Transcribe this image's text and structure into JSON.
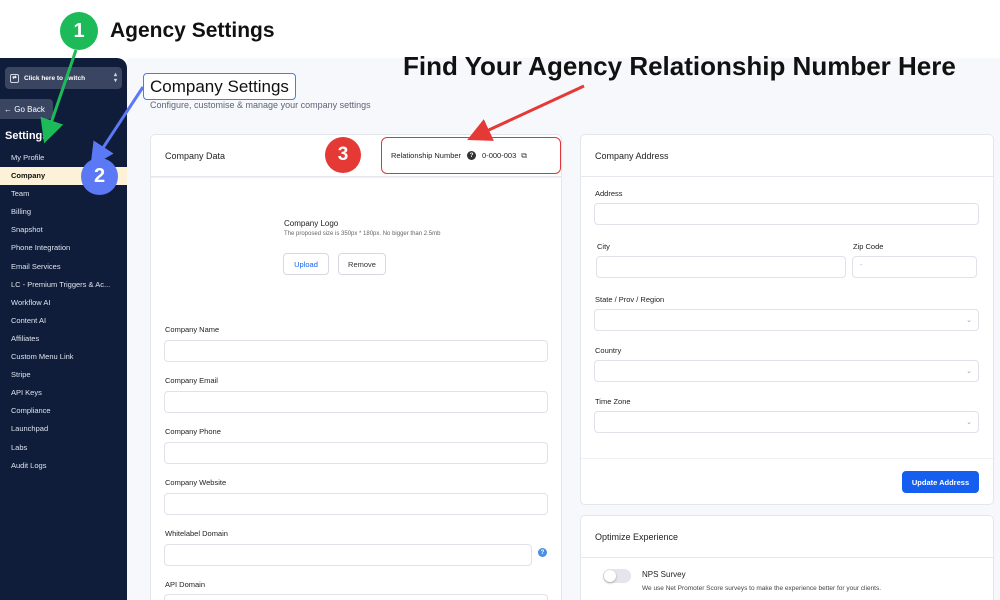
{
  "annotations": {
    "badge1": "1",
    "badge1_text": "Agency Settings",
    "badge2": "2",
    "badge3": "3",
    "headline": "Find Your Agency Relationship Number Here",
    "colors": {
      "green": "#1dba5a",
      "blue": "#5b79f5",
      "red": "#e53935"
    }
  },
  "sidebar": {
    "switcher_label": "Click here to switch",
    "go_back": "← Go Back",
    "title": "Settings",
    "items": [
      {
        "label": "My Profile"
      },
      {
        "label": "Company"
      },
      {
        "label": "Team"
      },
      {
        "label": "Billing"
      },
      {
        "label": "Snapshot"
      },
      {
        "label": "Phone Integration"
      },
      {
        "label": "Email Services"
      },
      {
        "label": "LC - Premium Triggers & Ac..."
      },
      {
        "label": "Workflow AI"
      },
      {
        "label": "Content AI"
      },
      {
        "label": "Affiliates"
      },
      {
        "label": "Custom Menu Link"
      },
      {
        "label": "Stripe"
      },
      {
        "label": "API Keys"
      },
      {
        "label": "Compliance"
      },
      {
        "label": "Launchpad"
      },
      {
        "label": "Labs"
      },
      {
        "label": "Audit Logs"
      }
    ],
    "active_index": 1
  },
  "page": {
    "title": "Company Settings",
    "subtitle": "Configure, customise & manage your company settings"
  },
  "company_data": {
    "header": "Company Data",
    "relationship_label": "Relationship Number",
    "relationship_number": "0-000-003",
    "logo_title": "Company Logo",
    "logo_hint": "The proposed size is 350px * 180px. No bigger than 2.5mb",
    "upload_label": "Upload",
    "remove_label": "Remove",
    "fields": {
      "name": "Company Name",
      "email": "Company Email",
      "phone": "Company Phone",
      "website": "Company Website",
      "whitelabel": "Whitelabel Domain",
      "api": "API Domain"
    }
  },
  "company_address": {
    "header": "Company Address",
    "address": "Address",
    "city": "City",
    "zip": "Zip Code",
    "zip_value": "-",
    "state": "State / Prov / Region",
    "country": "Country",
    "timezone": "Time Zone",
    "update_label": "Update Address"
  },
  "optimize": {
    "header": "Optimize Experience",
    "nps_title": "NPS Survey",
    "nps_desc": "We use Net Promoter Score surveys to make the experience better for your clients."
  }
}
